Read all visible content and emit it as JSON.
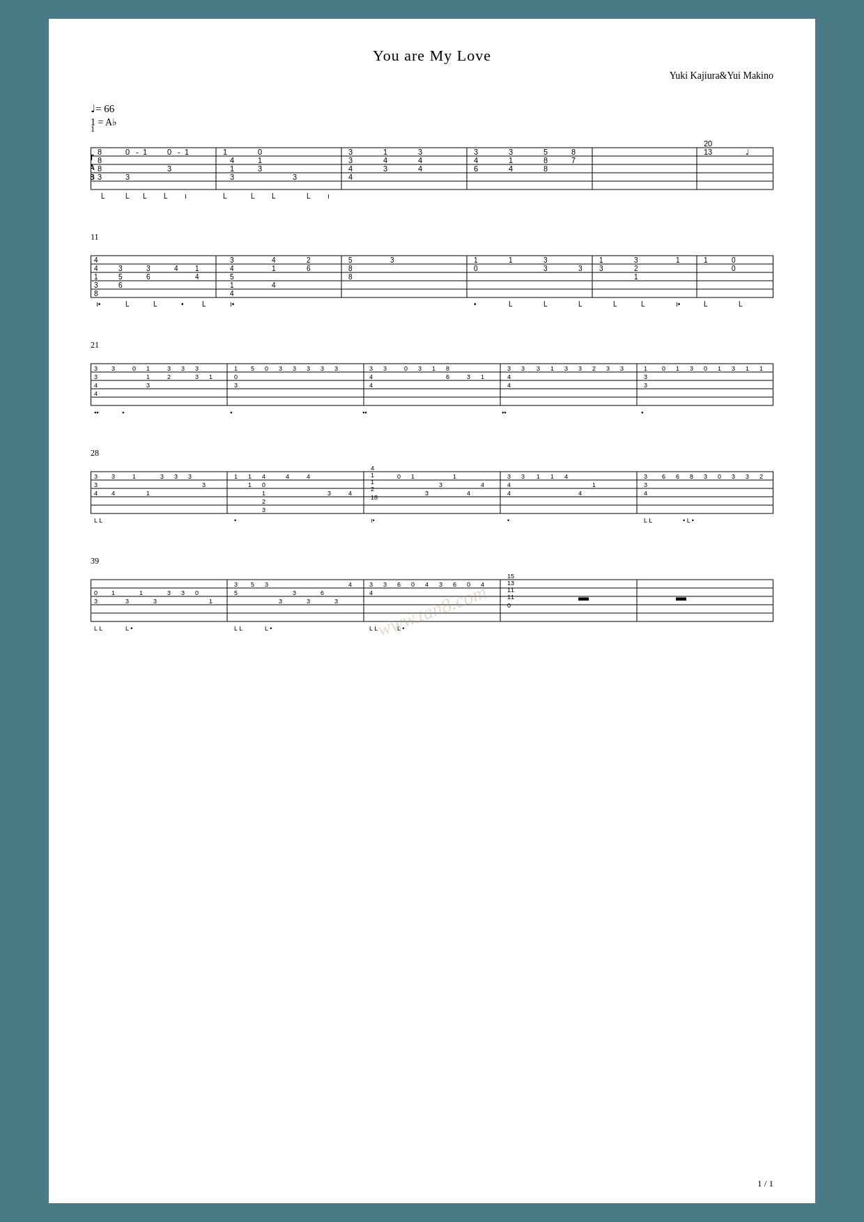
{
  "page": {
    "title": "You are My Love",
    "composer": "Yuki Kajiura&Yui Makino",
    "tempo": "♩= 66",
    "key": "1 = A♭",
    "watermark": "www.tan8.com",
    "page_number": "1 / 1",
    "background_color": "#4a7a85",
    "sheet_bg": "#ffffff"
  },
  "systems": [
    {
      "measure_start": 1,
      "label": "1"
    },
    {
      "measure_start": 11,
      "label": "11"
    },
    {
      "measure_start": 21,
      "label": "21"
    },
    {
      "measure_start": 28,
      "label": "28"
    },
    {
      "measure_start": 39,
      "label": "39"
    }
  ]
}
